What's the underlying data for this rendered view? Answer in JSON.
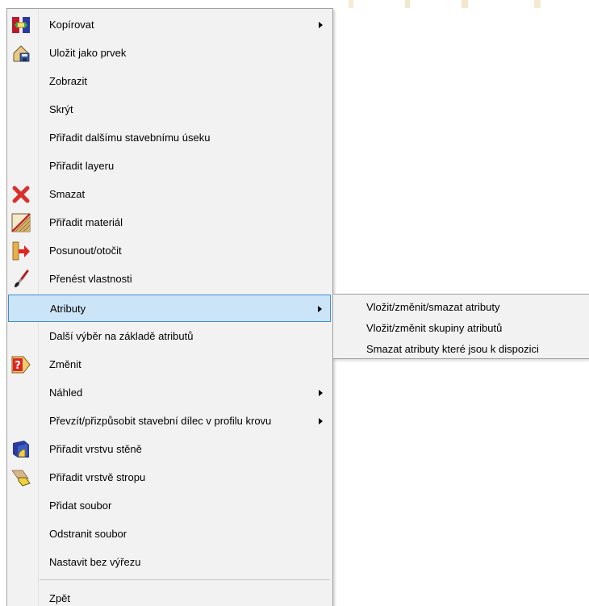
{
  "context_menu": {
    "items": [
      {
        "label": "Kopírovat",
        "icon": "copy-icon",
        "submenu": true
      },
      {
        "label": "Uložit jako prvek",
        "icon": "save-element-icon",
        "submenu": false
      },
      {
        "label": "Zobrazit",
        "icon": "",
        "submenu": false
      },
      {
        "label": "Skrýt",
        "icon": "",
        "submenu": false
      },
      {
        "label": "Přiřadit dalšímu stavebnímu úseku",
        "icon": "",
        "submenu": false
      },
      {
        "label": "Přiřadit layeru",
        "icon": "",
        "submenu": false
      },
      {
        "label": "Smazat",
        "icon": "delete-icon",
        "submenu": false
      },
      {
        "label": "Přiřadit materiál",
        "icon": "material-icon",
        "submenu": false
      },
      {
        "label": "Posunout/otočit",
        "icon": "move-rotate-icon",
        "submenu": false
      },
      {
        "label": "Přenést vlastnosti",
        "icon": "brush-icon",
        "submenu": false
      },
      {
        "label": "Atributy",
        "icon": "",
        "submenu": true,
        "highlighted": true
      },
      {
        "label": "Další výběr na základě atributů",
        "icon": "",
        "submenu": false
      },
      {
        "label": "Změnit",
        "icon": "modify-icon",
        "submenu": false
      },
      {
        "label": "Náhled",
        "icon": "",
        "submenu": true
      },
      {
        "label": "Převzít/přizpůsobit stavební dílec v profilu krovu",
        "icon": "",
        "submenu": true
      },
      {
        "label": "Přiřadit vrstvu stěně",
        "icon": "wall-layer-icon",
        "submenu": false
      },
      {
        "label": "Přiřadit vrstvě stropu",
        "icon": "ceiling-layer-icon",
        "submenu": false
      },
      {
        "label": "Přidat soubor",
        "icon": "",
        "submenu": false
      },
      {
        "label": "Odstranit soubor",
        "icon": "",
        "submenu": false
      },
      {
        "label": "Nastavit bez výřezu",
        "icon": "",
        "submenu": false
      },
      {
        "label": "Zpět",
        "icon": "",
        "submenu": false
      }
    ]
  },
  "attributes_submenu": {
    "items": [
      {
        "label": "Vložit/změnit/smazat atributy"
      },
      {
        "label": "Vložit/změnit skupiny atributů"
      },
      {
        "label": "Smazat atributy které jsou k dispozici"
      }
    ]
  },
  "colors": {
    "menu_background": "#f2f2f2",
    "highlight_fill": "#cce4f7",
    "highlight_border": "#3d8bd6",
    "delete_red": "#d9302c"
  }
}
